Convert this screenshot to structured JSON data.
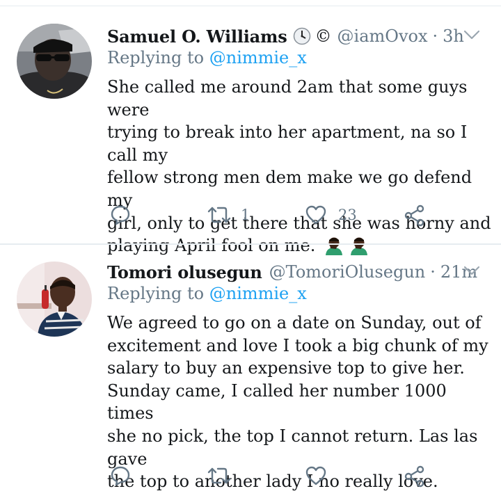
{
  "tweets": [
    {
      "name": "Samuel O. Williams",
      "badges": [
        "clock-icon",
        "copyright-symbol"
      ],
      "copyright_symbol": "©",
      "handle": "@iamOvox",
      "separator": "·",
      "time": "3h",
      "replying_prefix": "Replying to",
      "replying_to": "@nimmie_x",
      "lines": [
        "She called me around 2am that some guys were",
        "trying to break into her apartment, na so I call my",
        "fellow strong men dem make we go defend my",
        "girl, only to get there that she was horny and",
        "playing April fool on me."
      ],
      "emojis": [
        "facepalm-emoji",
        "facepalm-emoji"
      ],
      "actions": {
        "reply_count": "",
        "retweet_count": "1",
        "like_count": "23"
      }
    },
    {
      "name": "Tomori olusegun",
      "handle": "@TomoriOlusegun",
      "separator": "·",
      "time": "21m",
      "replying_prefix": "Replying to",
      "replying_to": "@nimmie_x",
      "lines": [
        "We agreed to go on a date on Sunday, out of",
        "excitement and love I took a big chunk of my",
        "salary to buy an expensive top to give her.",
        "Sunday came, I called her number 1000 times",
        "she no pick, the top I cannot return. Las las gave",
        "the top to another lady I no really love."
      ],
      "actions": {
        "reply_count": "",
        "retweet_count": "",
        "like_count": ""
      }
    }
  ],
  "colors": {
    "text": "#14171a",
    "secondary": "#657786",
    "link": "#1da1f2",
    "divider": "#e6ecf0"
  }
}
